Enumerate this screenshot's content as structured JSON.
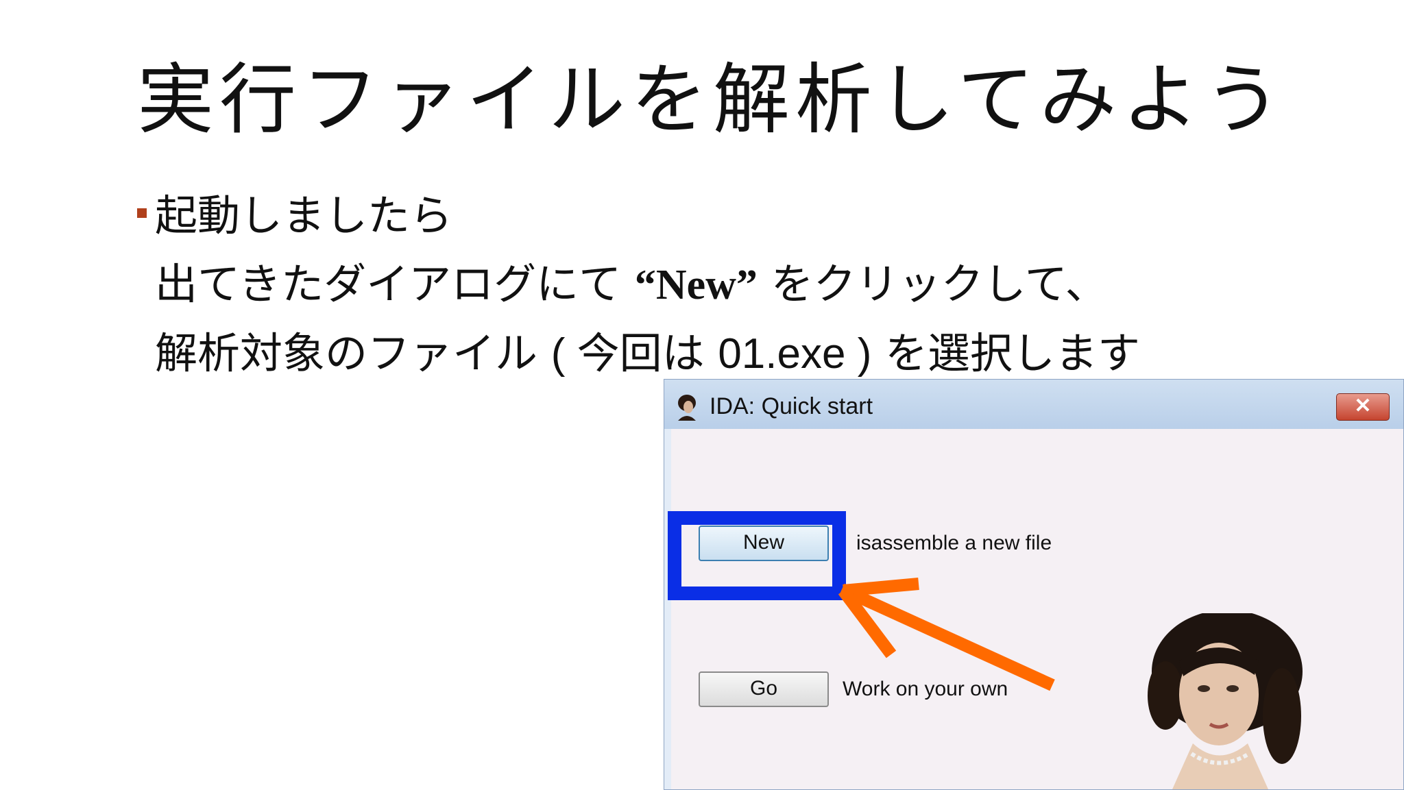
{
  "slide": {
    "title": "実行ファイルを解析してみよう",
    "line1": "起動しましたら",
    "line2_pre": "出てきたダイアログにて ",
    "line2_bold": "“New”",
    "line2_post": " をクリックして、",
    "line3_pre": "解析対象のファイル ",
    "line3_paren_open": "( ",
    "line3_mid": "今回は ",
    "line3_file": "01.exe",
    "line3_paren_close": " )",
    "line3_post": " を選択します"
  },
  "dialog": {
    "title": "IDA: Quick start",
    "close_glyph": "✕",
    "new_button": "New",
    "new_desc": "isassemble a new file",
    "go_button": "Go",
    "go_desc": "Work on your own"
  },
  "colors": {
    "bullet": "#b0401c",
    "highlight": "#0a2ee6",
    "arrow": "#ff6a00"
  },
  "icons": [
    "app-portrait-icon",
    "close-icon",
    "portrait-image"
  ]
}
